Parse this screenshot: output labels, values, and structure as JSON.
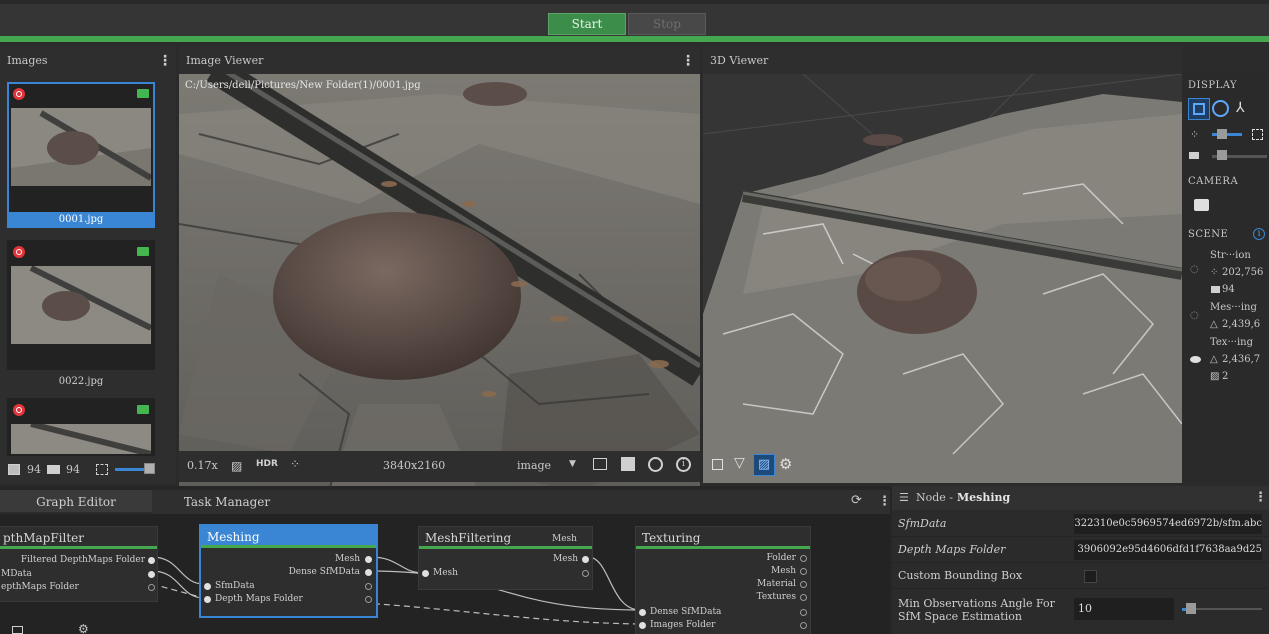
{
  "toolbar": {
    "start_label": "Start",
    "stop_label": "Stop"
  },
  "images_panel": {
    "title": "Images",
    "thumbs": [
      {
        "label": "0001.jpg",
        "selected": true
      },
      {
        "label": "0022.jpg",
        "selected": false
      },
      {
        "label": "",
        "selected": false
      }
    ],
    "footer": {
      "image_count": "94",
      "camera_count": "94"
    }
  },
  "image_viewer": {
    "title": "Image Viewer",
    "path": "C:/Users/dell/Pictures/New Folder(1)/0001.jpg",
    "zoom": "0.17x",
    "hdr_label": "HDR",
    "resolution": "3840x2160",
    "mode": "image"
  },
  "viewer3d": {
    "title": "3D Viewer"
  },
  "display_panel": {
    "display_header": "DISPLAY",
    "camera_header": "CAMERA",
    "scene_header": "SCENE",
    "scene_items": [
      {
        "name": "Str···ion",
        "points": "202,756",
        "cams": "94"
      },
      {
        "name": "Mes···ing",
        "tris": "2,439,6"
      },
      {
        "name": "Tex···ing",
        "tris": "2,436,7",
        "tex": "2"
      }
    ]
  },
  "graph_editor": {
    "tabs": [
      "Graph Editor",
      "Task Manager"
    ],
    "nodes": {
      "depthfilter": {
        "title": "pthMapFilter",
        "out": "Filtered DepthMaps Folder",
        "in1": "MData",
        "in2": "epthMaps Folder"
      },
      "meshing": {
        "title": "Meshing",
        "out1": "Mesh",
        "out2": "Dense SfMData",
        "in1": "SfmData",
        "in2": "Depth Maps Folder"
      },
      "meshfiltering": {
        "title": "MeshFiltering",
        "out": "Mesh",
        "in": "Mesh"
      },
      "texturing": {
        "title": "Texturing",
        "o1": "Mesh",
        "o2": "Folder",
        "o3": "Mesh",
        "o4": "Material",
        "o5": "Textures",
        "in1": "Dense SfMData",
        "in2": "Images Folder"
      }
    }
  },
  "attributes": {
    "title_prefix": "Node - ",
    "title_node": "Meshing",
    "rows": [
      {
        "label": "SfmData",
        "value": "322310e0c5969574ed6972b/sfm.abc"
      },
      {
        "label": "Depth Maps Folder",
        "value": "3906092e95d4606dfd1f7638aa9d25"
      },
      {
        "label": "Custom Bounding Box",
        "value": ""
      },
      {
        "label": "Min Observations Angle For SfM Space Estimation",
        "value": "10"
      }
    ]
  }
}
